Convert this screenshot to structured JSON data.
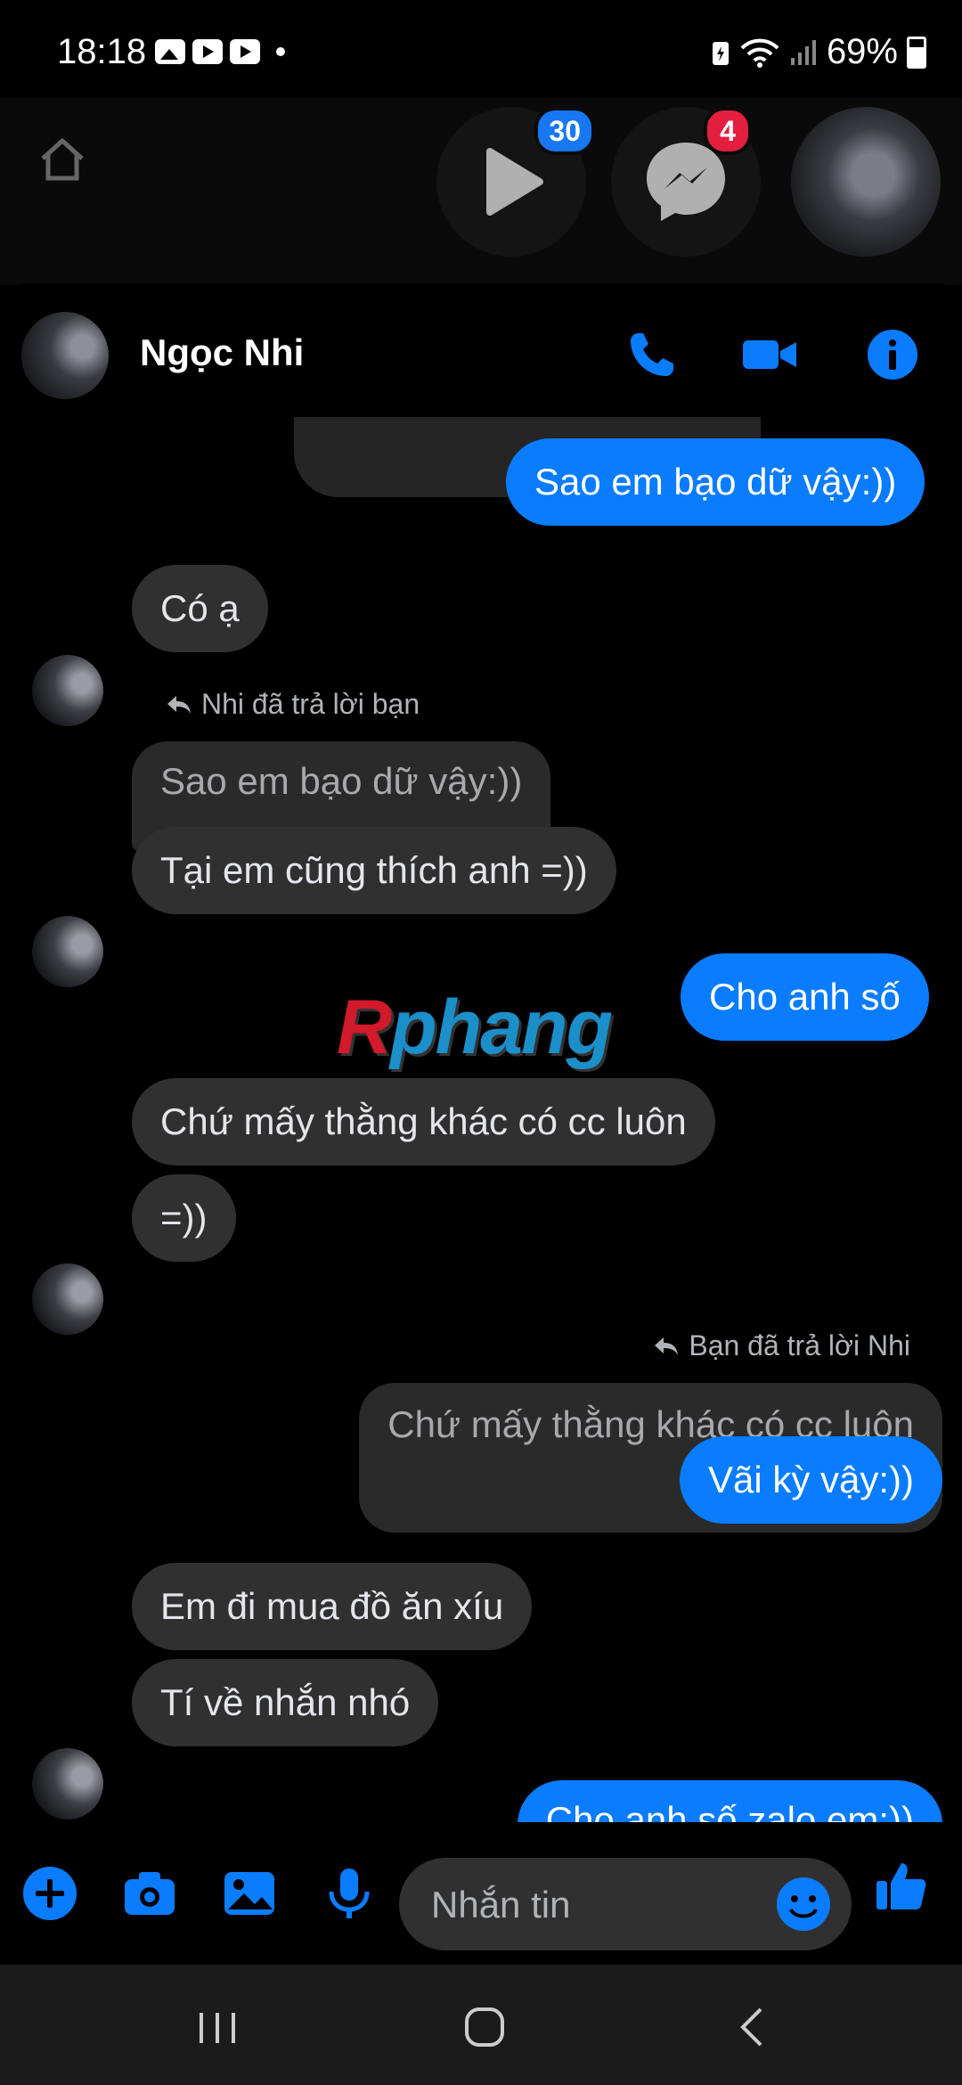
{
  "status_bar": {
    "time": "18:18",
    "battery": "69%"
  },
  "chat_heads": {
    "video_badge": "30",
    "messenger_badge": "4"
  },
  "header": {
    "contact_name": "Ngọc Nhi"
  },
  "watermark": {
    "r": "R",
    "rest": "phang"
  },
  "messages": {
    "m1": "Sao em bạo dữ vậy:))",
    "m2": "Có ạ",
    "reply1_label": "Nhi đã trả lời bạn",
    "reply1_quote": "Sao em bạo dữ vậy:))",
    "m3": "Tại em cũng thích anh =))",
    "m4": "Cho anh số",
    "m5": "Chứ mấy thằng khác có cc luôn",
    "m6": "=))",
    "reply2_label": "Bạn đã trả lời Nhi",
    "reply2_quote": "Chứ mấy thằng khác có cc luôn",
    "m7": "Vãi kỳ vậy:))",
    "m8": "Em đi mua đồ ăn xíu",
    "m9": "Tí về nhắn nhó",
    "m10": "Cho anh số zalo em:))"
  },
  "composer": {
    "placeholder": "Nhắn tin"
  },
  "colors": {
    "accent": "#0a7cff",
    "incoming_bubble": "#303030",
    "badge_blue": "#1877f2",
    "badge_red": "#e41e3f"
  }
}
